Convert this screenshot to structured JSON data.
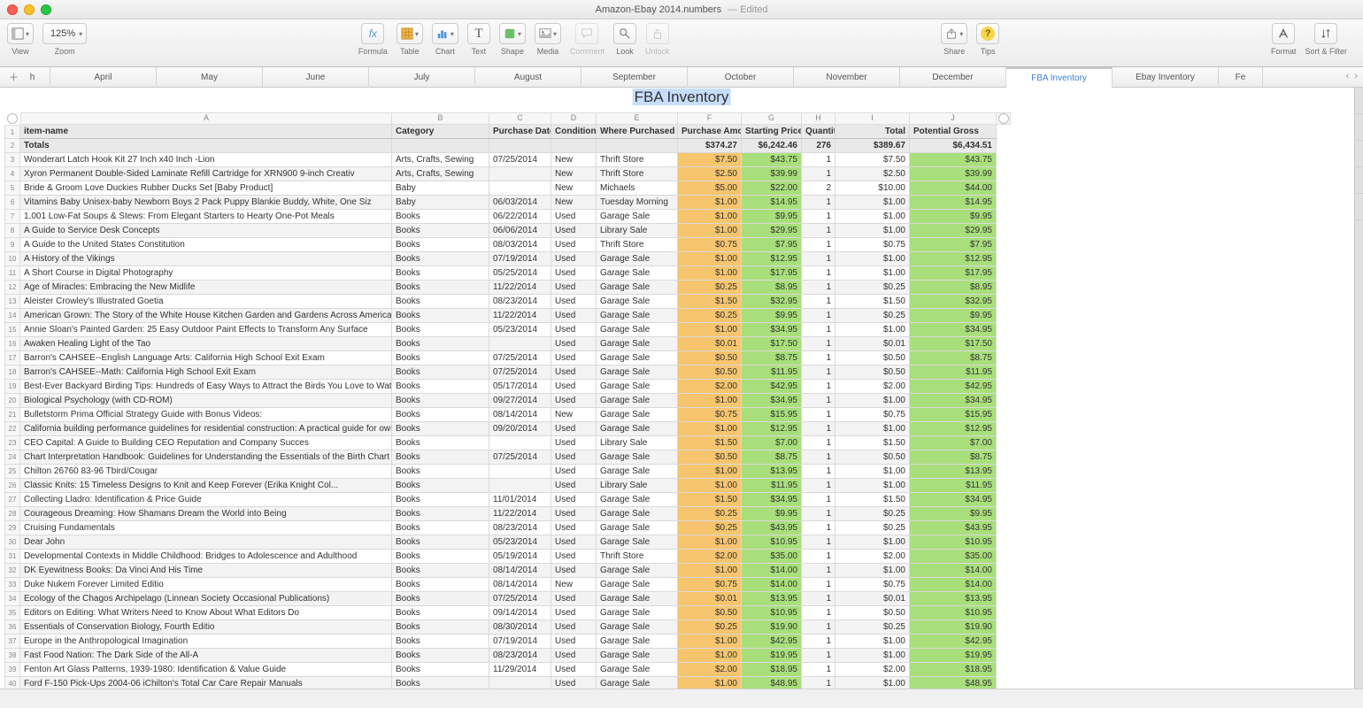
{
  "window": {
    "title": "Amazon-Ebay 2014.numbers",
    "edited": "— Edited",
    "doc_icon": "square"
  },
  "toolbar": {
    "view_label": "View",
    "zoom_label": "Zoom",
    "zoom_value": "125%",
    "formula_label": "Formula",
    "table_label": "Table",
    "chart_label": "Chart",
    "text_label": "Text",
    "shape_label": "Shape",
    "media_label": "Media",
    "comment_label": "Comment",
    "look_label": "Look",
    "unlock_label": "Unlock",
    "share_label": "Share",
    "tips_label": "Tips",
    "format_label": "Format",
    "sort_filter_label": "Sort & Filter"
  },
  "tabs": {
    "items": [
      "h",
      "April",
      "May",
      "June",
      "July",
      "August",
      "September",
      "October",
      "November",
      "December",
      "FBA Inventory",
      "Ebay Inventory",
      "Fe"
    ],
    "active_index": 10
  },
  "table": {
    "title": "FBA Inventory",
    "columns_letters": [
      "A",
      "B",
      "C",
      "D",
      "E",
      "F",
      "G",
      "H",
      "I",
      "J"
    ],
    "headers": [
      "item-name",
      "Category",
      "Purchase Date",
      "Condition",
      "Where Purchased",
      "Purchase Amount",
      "Starting Price",
      "Quantity",
      "Total",
      "Potential Gross"
    ],
    "totals": {
      "label": "Totals",
      "F": "$374.27",
      "G": "$6,242.46",
      "H": "276",
      "I": "$389.67",
      "J": "$6,434.51"
    },
    "rows": [
      {
        "n": 3,
        "A": "Wonderart Latch Hook Kit 27 Inch x40 Inch -Lion",
        "B": "Arts, Crafts, Sewing",
        "C": "07/25/2014",
        "D": "New",
        "E": "Thrift Store",
        "F": "$7.50",
        "G": "$43.75",
        "H": "1",
        "I": "$7.50",
        "J": "$43.75"
      },
      {
        "n": 4,
        "A": "Xyron Permanent Double-Sided Laminate Refill Cartridge for XRN900 9-inch Creativ",
        "B": "Arts, Crafts, Sewing",
        "C": "",
        "D": "New",
        "E": "Thrift Store",
        "F": "$2.50",
        "G": "$39.99",
        "H": "1",
        "I": "$2.50",
        "J": "$39.99"
      },
      {
        "n": 5,
        "A": "Bride & Groom Love Duckies Rubber Ducks Set [Baby Product]",
        "B": "Baby",
        "C": "",
        "D": "New",
        "E": "Michaels",
        "F": "$5.00",
        "G": "$22.00",
        "H": "2",
        "I": "$10.00",
        "J": "$44.00"
      },
      {
        "n": 6,
        "A": "Vitamins Baby Unisex-baby Newborn Boys 2 Pack Puppy Blankie Buddy, White, One Siz",
        "B": "Baby",
        "C": "06/03/2014",
        "D": "New",
        "E": "Tuesday Morning",
        "F": "$1.00",
        "G": "$14.95",
        "H": "1",
        "I": "$1.00",
        "J": "$14.95"
      },
      {
        "n": 7,
        "A": "1,001 Low-Fat Soups & Stews: From Elegant Starters to Hearty One-Pot Meals",
        "B": "Books",
        "C": "06/22/2014",
        "D": "Used",
        "E": "Garage Sale",
        "F": "$1.00",
        "G": "$9.95",
        "H": "1",
        "I": "$1.00",
        "J": "$9.95"
      },
      {
        "n": 8,
        "A": "A Guide to Service Desk Concepts",
        "B": "Books",
        "C": "06/06/2014",
        "D": "Used",
        "E": "Library Sale",
        "F": "$1.00",
        "G": "$29.95",
        "H": "1",
        "I": "$1.00",
        "J": "$29.95"
      },
      {
        "n": 9,
        "A": "A Guide to the United States Constitution",
        "B": "Books",
        "C": "08/03/2014",
        "D": "Used",
        "E": "Thrift Store",
        "F": "$0.75",
        "G": "$7.95",
        "H": "1",
        "I": "$0.75",
        "J": "$7.95"
      },
      {
        "n": 10,
        "A": "A History of the Vikings",
        "B": "Books",
        "C": "07/19/2014",
        "D": "Used",
        "E": "Garage Sale",
        "F": "$1.00",
        "G": "$12.95",
        "H": "1",
        "I": "$1.00",
        "J": "$12.95"
      },
      {
        "n": 11,
        "A": "A Short Course in Digital Photography",
        "B": "Books",
        "C": "05/25/2014",
        "D": "Used",
        "E": "Garage Sale",
        "F": "$1.00",
        "G": "$17.95",
        "H": "1",
        "I": "$1.00",
        "J": "$17.95"
      },
      {
        "n": 12,
        "A": "Age of Miracles: Embracing the New Midlife",
        "B": "Books",
        "C": "11/22/2014",
        "D": "Used",
        "E": "Garage Sale",
        "F": "$0.25",
        "G": "$8.95",
        "H": "1",
        "I": "$0.25",
        "J": "$8.95"
      },
      {
        "n": 13,
        "A": "Aleister Crowley's Illustrated Goetia",
        "B": "Books",
        "C": "08/23/2014",
        "D": "Used",
        "E": "Garage Sale",
        "F": "$1.50",
        "G": "$32.95",
        "H": "1",
        "I": "$1.50",
        "J": "$32.95"
      },
      {
        "n": 14,
        "A": "American Grown: The Story of the White House Kitchen Garden and Gardens Across America",
        "B": "Books",
        "C": "11/22/2014",
        "D": "Used",
        "E": "Garage Sale",
        "F": "$0.25",
        "G": "$9.95",
        "H": "1",
        "I": "$0.25",
        "J": "$9.95"
      },
      {
        "n": 15,
        "A": "Annie Sloan's Painted Garden: 25 Easy Outdoor Paint Effects to Transform Any Surface",
        "B": "Books",
        "C": "05/23/2014",
        "D": "Used",
        "E": "Garage Sale",
        "F": "$1.00",
        "G": "$34.95",
        "H": "1",
        "I": "$1.00",
        "J": "$34.95"
      },
      {
        "n": 16,
        "A": "Awaken Healing Light of the Tao",
        "B": "Books",
        "C": "",
        "D": "Used",
        "E": "Garage Sale",
        "F": "$0.01",
        "G": "$17.50",
        "H": "1",
        "I": "$0.01",
        "J": "$17.50"
      },
      {
        "n": 17,
        "A": "Barron's CAHSEE--English Language Arts: California High School Exit Exam",
        "B": "Books",
        "C": "07/25/2014",
        "D": "Used",
        "E": "Garage Sale",
        "F": "$0.50",
        "G": "$8.75",
        "H": "1",
        "I": "$0.50",
        "J": "$8.75"
      },
      {
        "n": 18,
        "A": "Barron's CAHSEE--Math: California High School Exit Exam",
        "B": "Books",
        "C": "07/25/2014",
        "D": "Used",
        "E": "Garage Sale",
        "F": "$0.50",
        "G": "$11.95",
        "H": "1",
        "I": "$0.50",
        "J": "$11.95"
      },
      {
        "n": 19,
        "A": "Best-Ever Backyard Birding Tips: Hundreds of Easy Ways to Attract the Birds You Love to Watch",
        "B": "Books",
        "C": "05/17/2014",
        "D": "Used",
        "E": "Garage Sale",
        "F": "$2.00",
        "G": "$42.95",
        "H": "1",
        "I": "$2.00",
        "J": "$42.95"
      },
      {
        "n": 20,
        "A": "Biological Psychology (with CD-ROM)",
        "B": "Books",
        "C": "09/27/2014",
        "D": "Used",
        "E": "Garage Sale",
        "F": "$1.00",
        "G": "$34.95",
        "H": "1",
        "I": "$1.00",
        "J": "$34.95"
      },
      {
        "n": 21,
        "A": "Bulletstorm Prima Official Strategy Guide with Bonus Videos:",
        "B": "Books",
        "C": "08/14/2014",
        "D": "New",
        "E": "Garage Sale",
        "F": "$0.75",
        "G": "$15.95",
        "H": "1",
        "I": "$0.75",
        "J": "$15.95"
      },
      {
        "n": 22,
        "A": "California building performance guidelines for residential construction: A practical guide for owners of new homes : constr",
        "B": "Books",
        "C": "09/20/2014",
        "D": "Used",
        "E": "Garage Sale",
        "F": "$1.00",
        "G": "$12.95",
        "H": "1",
        "I": "$1.00",
        "J": "$12.95"
      },
      {
        "n": 23,
        "A": "CEO Capital: A Guide to Building CEO Reputation and Company Succes",
        "B": "Books",
        "C": "",
        "D": "Used",
        "E": "Library Sale",
        "F": "$1.50",
        "G": "$7.00",
        "H": "1",
        "I": "$1.50",
        "J": "$7.00"
      },
      {
        "n": 24,
        "A": "Chart Interpretation Handbook: Guidelines for Understanding the Essentials of the Birth Chart",
        "B": "Books",
        "C": "07/25/2014",
        "D": "Used",
        "E": "Garage Sale",
        "F": "$0.50",
        "G": "$8.75",
        "H": "1",
        "I": "$0.50",
        "J": "$8.75"
      },
      {
        "n": 25,
        "A": "Chilton 26760 83-96 Tbird/Cougar",
        "B": "Books",
        "C": "",
        "D": "Used",
        "E": "Garage Sale",
        "F": "$1.00",
        "G": "$13.95",
        "H": "1",
        "I": "$1.00",
        "J": "$13.95"
      },
      {
        "n": 26,
        "A": "Classic Knits: 15 Timeless Designs to Knit and Keep Forever (Erika Knight Col...",
        "B": "Books",
        "C": "",
        "D": "Used",
        "E": "Library Sale",
        "F": "$1.00",
        "G": "$11.95",
        "H": "1",
        "I": "$1.00",
        "J": "$11.95"
      },
      {
        "n": 27,
        "A": "Collecting Lladro: Identification & Price Guide",
        "B": "Books",
        "C": "11/01/2014",
        "D": "Used",
        "E": "Garage Sale",
        "F": "$1.50",
        "G": "$34.95",
        "H": "1",
        "I": "$1.50",
        "J": "$34.95"
      },
      {
        "n": 28,
        "A": "Courageous Dreaming: How Shamans Dream the World into Being",
        "B": "Books",
        "C": "11/22/2014",
        "D": "Used",
        "E": "Garage Sale",
        "F": "$0.25",
        "G": "$9.95",
        "H": "1",
        "I": "$0.25",
        "J": "$9.95"
      },
      {
        "n": 29,
        "A": "Cruising Fundamentals",
        "B": "Books",
        "C": "08/23/2014",
        "D": "Used",
        "E": "Garage Sale",
        "F": "$0.25",
        "G": "$43.95",
        "H": "1",
        "I": "$0.25",
        "J": "$43.95"
      },
      {
        "n": 30,
        "A": "Dear John",
        "B": "Books",
        "C": "05/23/2014",
        "D": "Used",
        "E": "Garage Sale",
        "F": "$1.00",
        "G": "$10.95",
        "H": "1",
        "I": "$1.00",
        "J": "$10.95"
      },
      {
        "n": 31,
        "A": "Developmental Contexts in Middle Childhood: Bridges to Adolescence and Adulthood",
        "B": "Books",
        "C": "05/19/2014",
        "D": "Used",
        "E": "Thrift Store",
        "F": "$2.00",
        "G": "$35.00",
        "H": "1",
        "I": "$2.00",
        "J": "$35.00"
      },
      {
        "n": 32,
        "A": "DK Eyewitness Books: Da Vinci And His Time",
        "B": "Books",
        "C": "08/14/2014",
        "D": "Used",
        "E": "Garage Sale",
        "F": "$1.00",
        "G": "$14.00",
        "H": "1",
        "I": "$1.00",
        "J": "$14.00"
      },
      {
        "n": 33,
        "A": "Duke Nukem Forever Limited Editio",
        "B": "Books",
        "C": "08/14/2014",
        "D": "New",
        "E": "Garage Sale",
        "F": "$0.75",
        "G": "$14.00",
        "H": "1",
        "I": "$0.75",
        "J": "$14.00"
      },
      {
        "n": 34,
        "A": "Ecology of the Chagos Archipelago (Linnean Society Occasional Publications)",
        "B": "Books",
        "C": "07/25/2014",
        "D": "Used",
        "E": "Garage Sale",
        "F": "$0.01",
        "G": "$13.95",
        "H": "1",
        "I": "$0.01",
        "J": "$13.95"
      },
      {
        "n": 35,
        "A": "Editors on Editing: What Writers Need to Know About What Editors Do",
        "B": "Books",
        "C": "09/14/2014",
        "D": "Used",
        "E": "Garage Sale",
        "F": "$0.50",
        "G": "$10.95",
        "H": "1",
        "I": "$0.50",
        "J": "$10.95"
      },
      {
        "n": 36,
        "A": "Essentials of Conservation Biology, Fourth Editio",
        "B": "Books",
        "C": "08/30/2014",
        "D": "Used",
        "E": "Garage Sale",
        "F": "$0.25",
        "G": "$19.90",
        "H": "1",
        "I": "$0.25",
        "J": "$19.90"
      },
      {
        "n": 37,
        "A": "Europe in the Anthropological Imagination",
        "B": "Books",
        "C": "07/19/2014",
        "D": "Used",
        "E": "Garage Sale",
        "F": "$1.00",
        "G": "$42.95",
        "H": "1",
        "I": "$1.00",
        "J": "$42.95"
      },
      {
        "n": 38,
        "A": "Fast Food Nation: The Dark Side of the All-A",
        "B": "Books",
        "C": "08/23/2014",
        "D": "Used",
        "E": "Garage Sale",
        "F": "$1.00",
        "G": "$19.95",
        "H": "1",
        "I": "$1.00",
        "J": "$19.95"
      },
      {
        "n": 39,
        "A": "Fenton Art Glass Patterns, 1939-1980: Identification & Value Guide",
        "B": "Books",
        "C": "11/29/2014",
        "D": "Used",
        "E": "Garage Sale",
        "F": "$2.00",
        "G": "$18.95",
        "H": "1",
        "I": "$2.00",
        "J": "$18.95"
      },
      {
        "n": 40,
        "A": "Ford F-150 Pick-Ups 2004-06 iChilton's Total Car Care Repair Manuals",
        "B": "Books",
        "C": "",
        "D": "Used",
        "E": "Garage Sale",
        "F": "$1.00",
        "G": "$48.95",
        "H": "1",
        "I": "$1.00",
        "J": "$48.95"
      }
    ]
  }
}
